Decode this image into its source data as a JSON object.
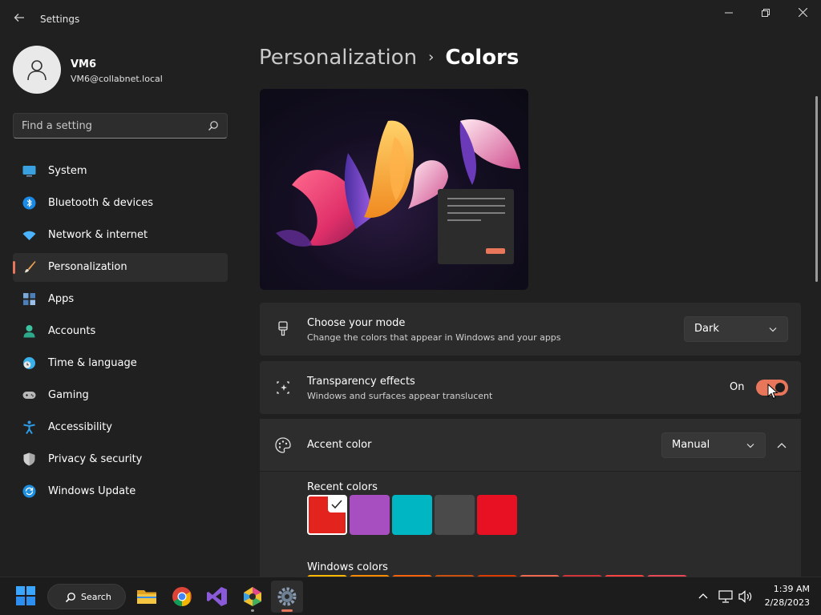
{
  "window": {
    "title": "Settings",
    "back_icon": "back-arrow-icon"
  },
  "profile": {
    "name": "VM6",
    "email": "VM6@collabnet.local"
  },
  "search": {
    "placeholder": "Find a setting"
  },
  "nav": {
    "items": [
      {
        "label": "System",
        "icon": "monitor-icon",
        "color": "#3aa0e0",
        "selected": false
      },
      {
        "label": "Bluetooth & devices",
        "icon": "bluetooth-icon",
        "color": "#1a8ae6",
        "selected": false
      },
      {
        "label": "Network & internet",
        "icon": "wifi-icon",
        "color": "#4bb3ff",
        "selected": false
      },
      {
        "label": "Personalization",
        "icon": "brush-icon",
        "color": "#f0a050",
        "selected": true
      },
      {
        "label": "Apps",
        "icon": "apps-icon",
        "color": "#7aa8d8",
        "selected": false
      },
      {
        "label": "Accounts",
        "icon": "person-icon",
        "color": "#3dc2a0",
        "selected": false
      },
      {
        "label": "Time & language",
        "icon": "globe-clock-icon",
        "color": "#3ab0e8",
        "selected": false
      },
      {
        "label": "Gaming",
        "icon": "gamepad-icon",
        "color": "#b8b8b8",
        "selected": false
      },
      {
        "label": "Accessibility",
        "icon": "accessibility-icon",
        "color": "#2e9de8",
        "selected": false
      },
      {
        "label": "Privacy & security",
        "icon": "shield-icon",
        "color": "#a8a8a8",
        "selected": false
      },
      {
        "label": "Windows Update",
        "icon": "sync-icon",
        "color": "#1e8fe0",
        "selected": false
      }
    ]
  },
  "breadcrumb": {
    "parent": "Personalization",
    "separator": "›",
    "current": "Colors"
  },
  "mode": {
    "title": "Choose your mode",
    "subtitle": "Change the colors that appear in Windows and your apps",
    "value": "Dark"
  },
  "transparency": {
    "title": "Transparency effects",
    "subtitle": "Windows and surfaces appear translucent",
    "state": "On"
  },
  "accent": {
    "title": "Accent color",
    "value": "Manual"
  },
  "recent_colors": {
    "title": "Recent colors",
    "colors": [
      "#e3241e",
      "#a74ec0",
      "#00b6c3",
      "#4a4a4a",
      "#e81123"
    ],
    "selected_index": 0
  },
  "windows_colors": {
    "title": "Windows colors",
    "colors": [
      "#ffb900",
      "#ff8c00",
      "#f7630c",
      "#ca5010",
      "#da3b01",
      "#ef6950",
      "#d13438",
      "#ff4343",
      "#e74856"
    ]
  },
  "accent_color": "#e8765a",
  "taskbar": {
    "search_label": "Search",
    "time": "1:39 AM",
    "date": "2/28/2023"
  }
}
